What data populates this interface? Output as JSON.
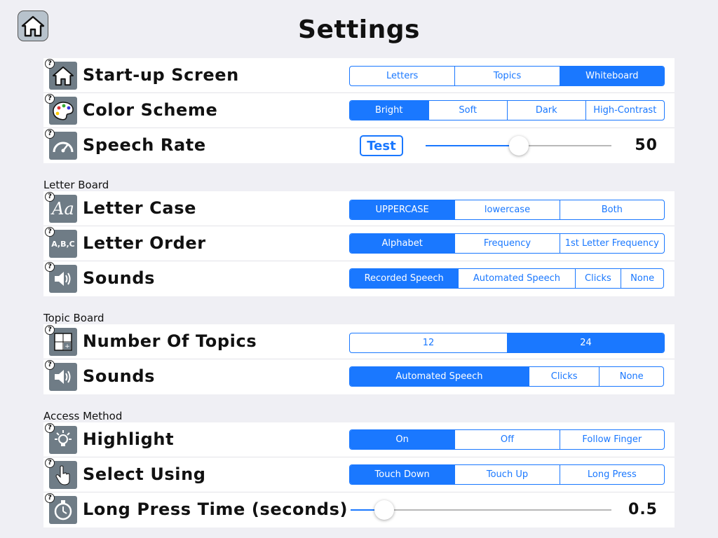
{
  "title": "Settings",
  "accent_color": "#1a78ff",
  "home_icon": "home-icon",
  "help_glyph": "?",
  "general": {
    "startup": {
      "label": "Start-up Screen",
      "icon": "home-icon",
      "options": [
        "Letters",
        "Topics",
        "Whiteboard"
      ],
      "selected": "Whiteboard"
    },
    "color_scheme": {
      "label": "Color Scheme",
      "icon": "palette-icon",
      "options": [
        "Bright",
        "Soft",
        "Dark",
        "High-Contrast"
      ],
      "selected": "Bright"
    },
    "speech_rate": {
      "label": "Speech Rate",
      "icon": "speedometer-icon",
      "test_label": "Test",
      "value": "50",
      "level": 0.5
    }
  },
  "letter_board": {
    "section_label": "Letter Board",
    "letter_case": {
      "label": "Letter Case",
      "icon": "letter-case-icon",
      "icon_text": "Aa",
      "options": [
        "UPPERCASE",
        "lowercase",
        "Both"
      ],
      "selected": "UPPERCASE"
    },
    "letter_order": {
      "label": "Letter Order",
      "icon": "letter-order-icon",
      "icon_text": "A,B,C",
      "options": [
        "Alphabet",
        "Frequency",
        "1st Letter Frequency"
      ],
      "selected": "Alphabet"
    },
    "sounds": {
      "label": "Sounds",
      "icon": "speaker-icon",
      "options": [
        "Recorded Speech",
        "Automated Speech",
        "Clicks",
        "None"
      ],
      "selected": "Recorded Speech"
    }
  },
  "topic_board": {
    "section_label": "Topic Board",
    "num_topics": {
      "label": "Number Of Topics",
      "icon": "grid-icon",
      "options": [
        "12",
        "24"
      ],
      "selected": "24"
    },
    "sounds": {
      "label": "Sounds",
      "icon": "speaker-icon",
      "options": [
        "Automated Speech",
        "Clicks",
        "None"
      ],
      "selected": "Automated Speech"
    }
  },
  "access_method": {
    "section_label": "Access Method",
    "highlight": {
      "label": "Highlight",
      "icon": "lightbulb-icon",
      "options": [
        "On",
        "Off",
        "Follow Finger"
      ],
      "selected": "On"
    },
    "select_using": {
      "label": "Select Using",
      "icon": "touch-hand-icon",
      "options": [
        "Touch Down",
        "Touch Up",
        "Long Press"
      ],
      "selected": "Touch Down"
    },
    "long_press_time": {
      "label": "Long Press Time (seconds)",
      "icon": "stopwatch-icon",
      "value": "0.5",
      "level": 0.13
    }
  }
}
